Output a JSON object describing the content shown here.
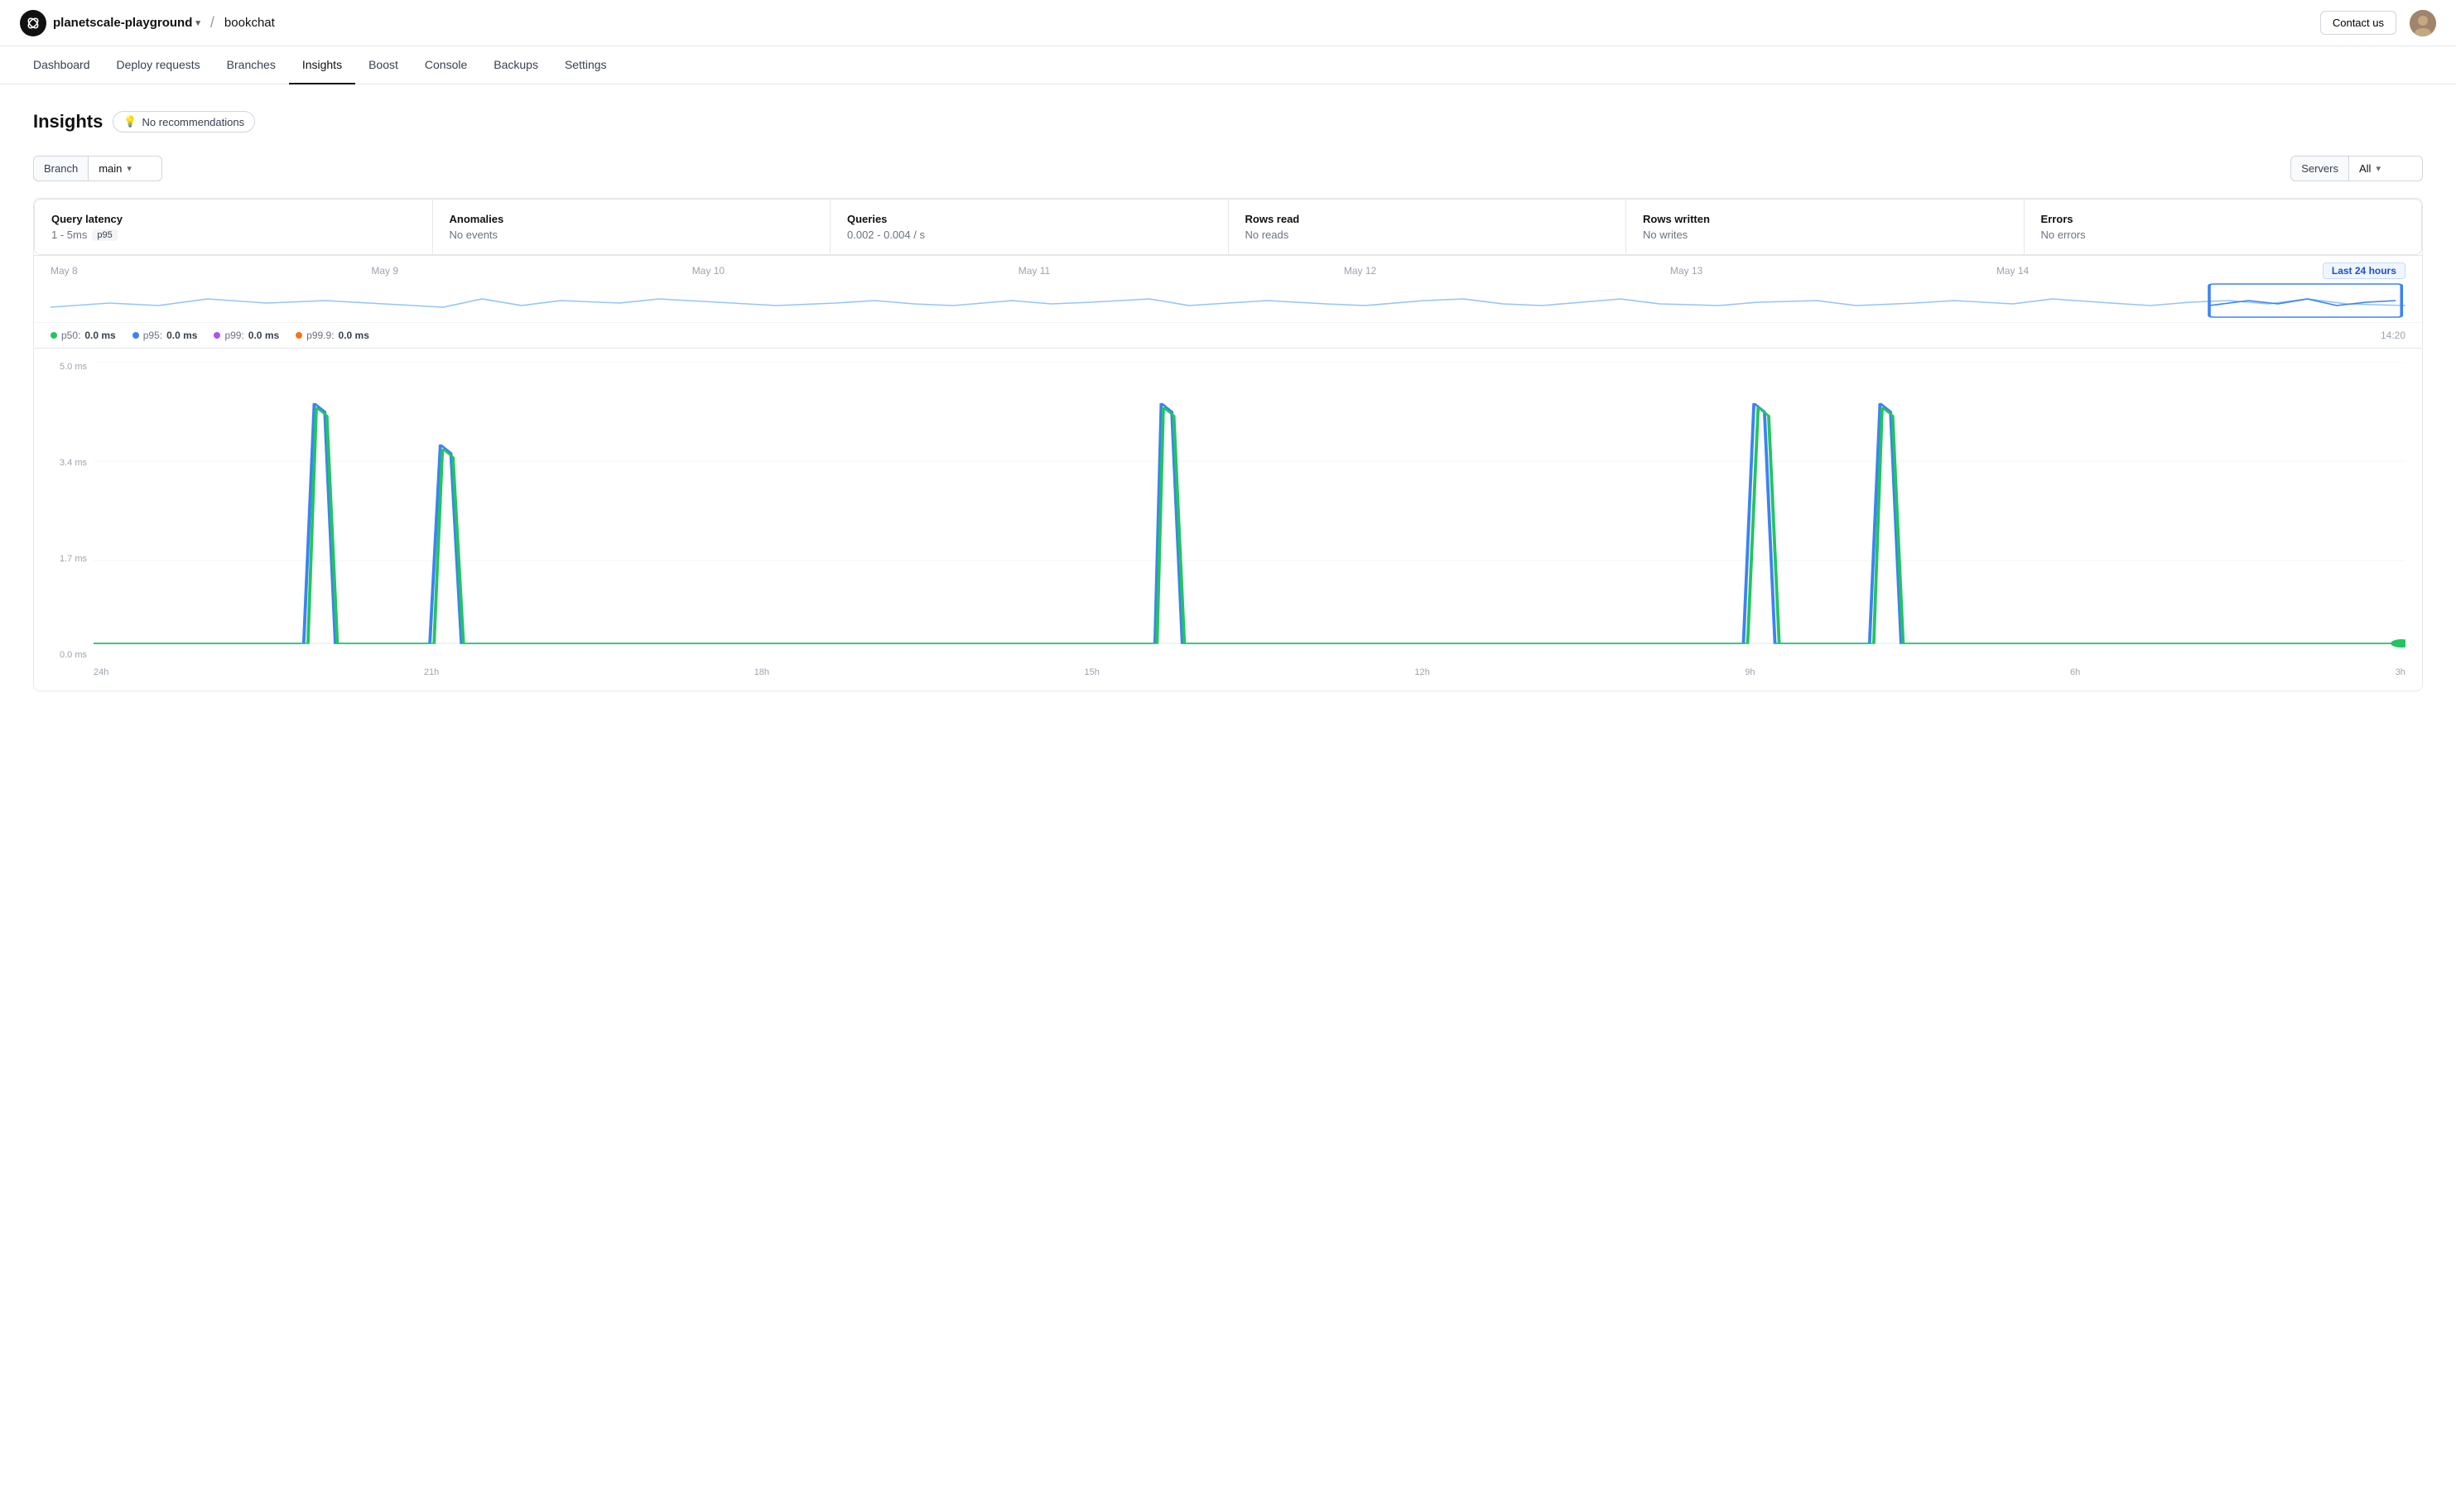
{
  "header": {
    "org_name": "planetscale-playground",
    "org_chevron": "▾",
    "separator": "/",
    "project_name": "bookchat",
    "contact_label": "Contact us"
  },
  "nav": {
    "items": [
      {
        "id": "dashboard",
        "label": "Dashboard",
        "active": false
      },
      {
        "id": "deploy-requests",
        "label": "Deploy requests",
        "active": false
      },
      {
        "id": "branches",
        "label": "Branches",
        "active": false
      },
      {
        "id": "insights",
        "label": "Insights",
        "active": true
      },
      {
        "id": "boost",
        "label": "Boost",
        "active": false
      },
      {
        "id": "console",
        "label": "Console",
        "active": false
      },
      {
        "id": "backups",
        "label": "Backups",
        "active": false
      },
      {
        "id": "settings",
        "label": "Settings",
        "active": false
      }
    ]
  },
  "page": {
    "title": "Insights",
    "recommendations_label": "No recommendations"
  },
  "filters": {
    "branch_label": "Branch",
    "branch_value": "main",
    "servers_label": "Servers",
    "servers_value": "All"
  },
  "stats": [
    {
      "id": "query-latency",
      "title": "Query latency",
      "value": "1 - 5ms",
      "badge": "p95"
    },
    {
      "id": "anomalies",
      "title": "Anomalies",
      "value": "No events"
    },
    {
      "id": "queries",
      "title": "Queries",
      "value": "0.002 - 0.004 / s"
    },
    {
      "id": "rows-read",
      "title": "Rows read",
      "value": "No reads"
    },
    {
      "id": "rows-written",
      "title": "Rows written",
      "value": "No writes"
    },
    {
      "id": "errors",
      "title": "Errors",
      "value": "No errors"
    }
  ],
  "timeline": {
    "dates": [
      "May 8",
      "May 9",
      "May 10",
      "May 11",
      "May 12",
      "May 13",
      "May 14"
    ],
    "last_period": "Last 24 hours"
  },
  "legend": {
    "items": [
      {
        "id": "p50",
        "label": "p50:",
        "value": "0.0 ms",
        "color": "#22c55e"
      },
      {
        "id": "p95",
        "label": "p95:",
        "value": "0.0 ms",
        "color": "#3b82f6"
      },
      {
        "id": "p99",
        "label": "p99:",
        "value": "0.0 ms",
        "color": "#a855f7"
      },
      {
        "id": "p999",
        "label": "p99.9:",
        "value": "0.0 ms",
        "color": "#f97316"
      }
    ],
    "time": "14:20"
  },
  "chart": {
    "y_labels": [
      "5.0 ms",
      "3.4 ms",
      "1.7 ms",
      "0.0 ms"
    ],
    "x_labels": [
      "24h",
      "21h",
      "18h",
      "15h",
      "12h",
      "9h",
      "6h",
      "3h"
    ]
  }
}
